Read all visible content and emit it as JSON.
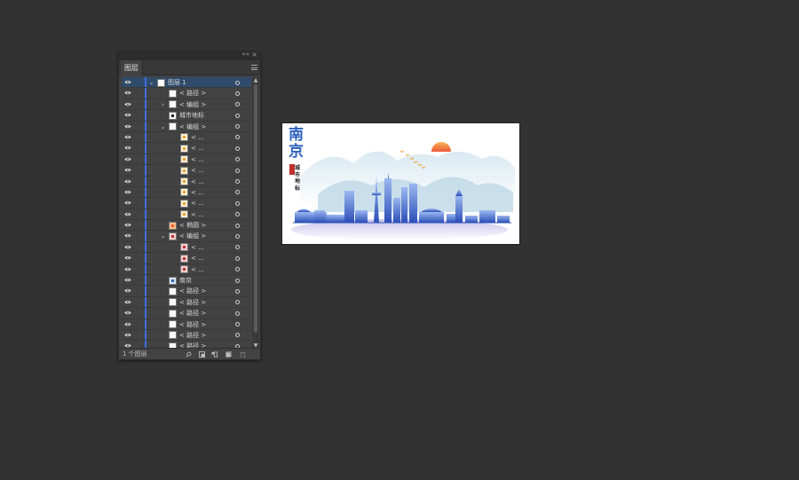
{
  "panel": {
    "tab_label": "图层",
    "collapse_glyph": "««",
    "close_glyph": "×",
    "menu_icon": "hamburger-menu-icon",
    "accent_color": "#3d6fe0",
    "selected_color": "#2f4a6a",
    "layers": [
      {
        "label": "图层 1",
        "level": 0,
        "expand": "open",
        "thumb": "plain",
        "selected": true
      },
      {
        "label": "< 路径 >",
        "level": 1,
        "expand": "none",
        "thumb": "plain"
      },
      {
        "label": "< 编组 >",
        "level": 1,
        "expand": "closed",
        "thumb": "plain"
      },
      {
        "label": "城市地标",
        "level": 1,
        "expand": "none",
        "thumb": "text"
      },
      {
        "label": "< 编组 >",
        "level": 1,
        "expand": "open",
        "thumb": "plain"
      },
      {
        "label": "< ...",
        "level": 2,
        "expand": "none",
        "thumb": "bird"
      },
      {
        "label": "< ...",
        "level": 2,
        "expand": "none",
        "thumb": "bird"
      },
      {
        "label": "< ...",
        "level": 2,
        "expand": "none",
        "thumb": "bird"
      },
      {
        "label": "< ...",
        "level": 2,
        "expand": "none",
        "thumb": "bird"
      },
      {
        "label": "< ...",
        "level": 2,
        "expand": "none",
        "thumb": "bird"
      },
      {
        "label": "< ...",
        "level": 2,
        "expand": "none",
        "thumb": "bird"
      },
      {
        "label": "< ...",
        "level": 2,
        "expand": "none",
        "thumb": "bird"
      },
      {
        "label": "< ...",
        "level": 2,
        "expand": "none",
        "thumb": "bird"
      },
      {
        "label": "< 椭圆 >",
        "level": 1,
        "expand": "none",
        "thumb": "sun"
      },
      {
        "label": "< 编组 >",
        "level": 1,
        "expand": "open",
        "thumb": "red"
      },
      {
        "label": "< ...",
        "level": 2,
        "expand": "none",
        "thumb": "red"
      },
      {
        "label": "< ...",
        "level": 2,
        "expand": "none",
        "thumb": "red"
      },
      {
        "label": "< ...",
        "level": 2,
        "expand": "none",
        "thumb": "red"
      },
      {
        "label": "南京",
        "level": 1,
        "expand": "none",
        "thumb": "blue"
      },
      {
        "label": "< 路径 >",
        "level": 1,
        "expand": "none",
        "thumb": "plain"
      },
      {
        "label": "< 路径 >",
        "level": 1,
        "expand": "none",
        "thumb": "plain"
      },
      {
        "label": "< 路径 >",
        "level": 1,
        "expand": "none",
        "thumb": "plain"
      },
      {
        "label": "< 路径 >",
        "level": 1,
        "expand": "none",
        "thumb": "plain"
      },
      {
        "label": "< 路径 >",
        "level": 1,
        "expand": "none",
        "thumb": "plain"
      },
      {
        "label": "< 路径 >",
        "level": 1,
        "expand": "none",
        "thumb": "plain"
      }
    ],
    "footer": {
      "count_text": "1 个图层",
      "icons": [
        "search-layer-icon",
        "clipping-mask-icon",
        "new-sublayer-icon",
        "new-layer-icon",
        "trash-icon"
      ]
    }
  },
  "artboard": {
    "title_chars": [
      "南",
      "京"
    ],
    "subtitle_chars": [
      "城",
      "市",
      "地",
      "标"
    ],
    "palette": {
      "ink": "#2f63bf",
      "mist": "#cfe3ee",
      "sun": "#f07a3a",
      "bird": "#f0a030"
    }
  }
}
